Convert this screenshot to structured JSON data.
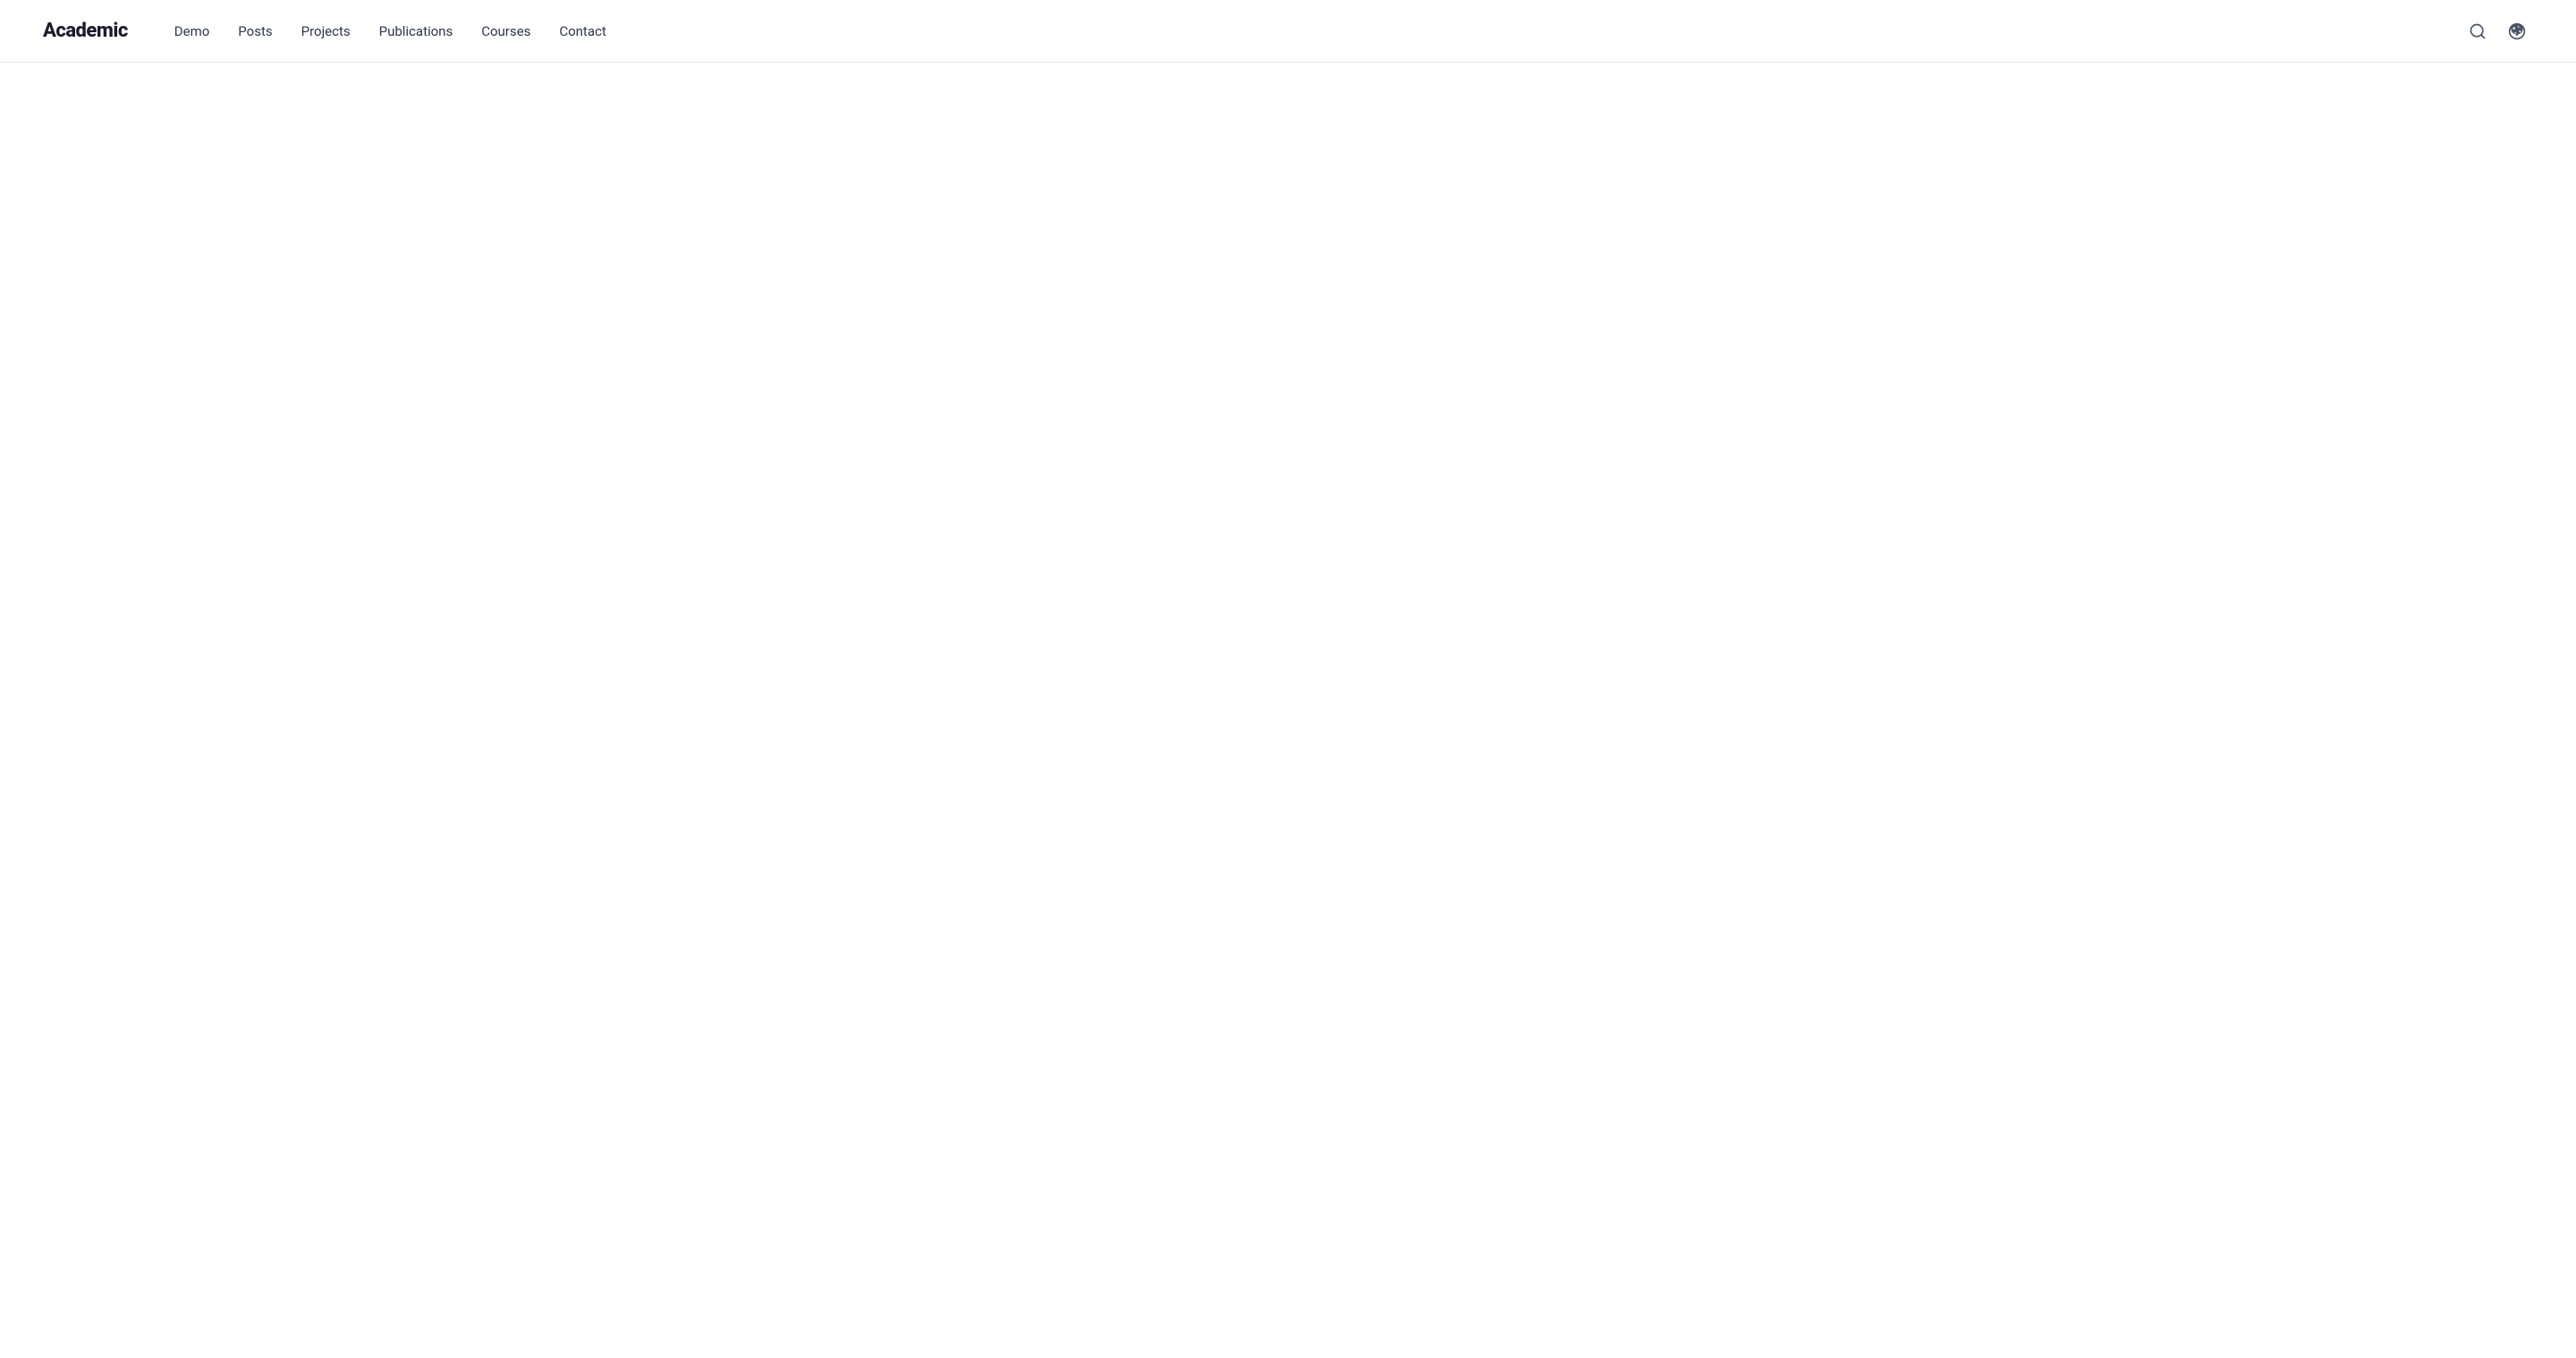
{
  "header": {
    "logo_text": "Academic",
    "nav_items": [
      {
        "id": "demo",
        "label": "Demo"
      },
      {
        "id": "posts",
        "label": "Posts"
      },
      {
        "id": "projects",
        "label": "Projects"
      },
      {
        "id": "publications",
        "label": "Publications"
      },
      {
        "id": "courses",
        "label": "Courses"
      },
      {
        "id": "contact",
        "label": "Contact"
      }
    ],
    "search_label": "Search",
    "theme_label": "Toggle theme"
  }
}
